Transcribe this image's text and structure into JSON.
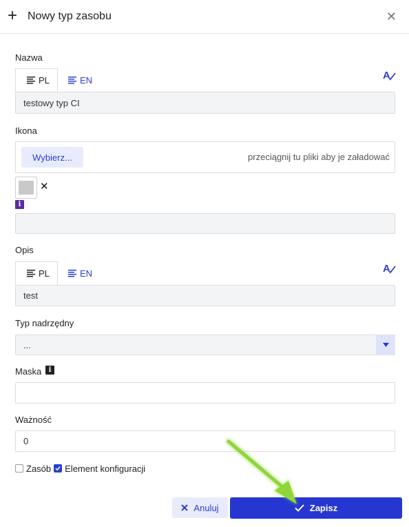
{
  "dialog": {
    "title": "Nowy typ zasobu",
    "plus_icon": "+",
    "close_icon": "✕"
  },
  "name_section": {
    "label": "Nazwa",
    "tabs": [
      "PL",
      "EN"
    ],
    "value": "testowy typ CI"
  },
  "icon_section": {
    "label": "Ikona",
    "choose_button": "Wybierz...",
    "drop_hint": "przeciągnij tu pliki aby je załadować",
    "remove_icon": "✕",
    "info_icon": "i",
    "extra_value": ""
  },
  "description_section": {
    "label": "Opis",
    "tabs": [
      "PL",
      "EN"
    ],
    "value": "test"
  },
  "parent_type": {
    "label": "Typ nadrzędny",
    "selected": "..."
  },
  "mask": {
    "label": "Maska",
    "info_icon": "i",
    "value": ""
  },
  "importance": {
    "label": "Ważność",
    "value": "0"
  },
  "checkboxes": {
    "resource": {
      "label": "Zasób",
      "checked": false
    },
    "config_element": {
      "label": "Element konfiguracji",
      "checked": true
    }
  },
  "footer": {
    "cancel_label": "Anuluj",
    "save_label": "Zapisz"
  },
  "colors": {
    "accent": "#2637d1",
    "accent_light": "#e8ebfb",
    "field_bg": "#f3f4f6",
    "info_badge": "#5a2ca0",
    "annotation_arrow": "#8fd63a"
  }
}
